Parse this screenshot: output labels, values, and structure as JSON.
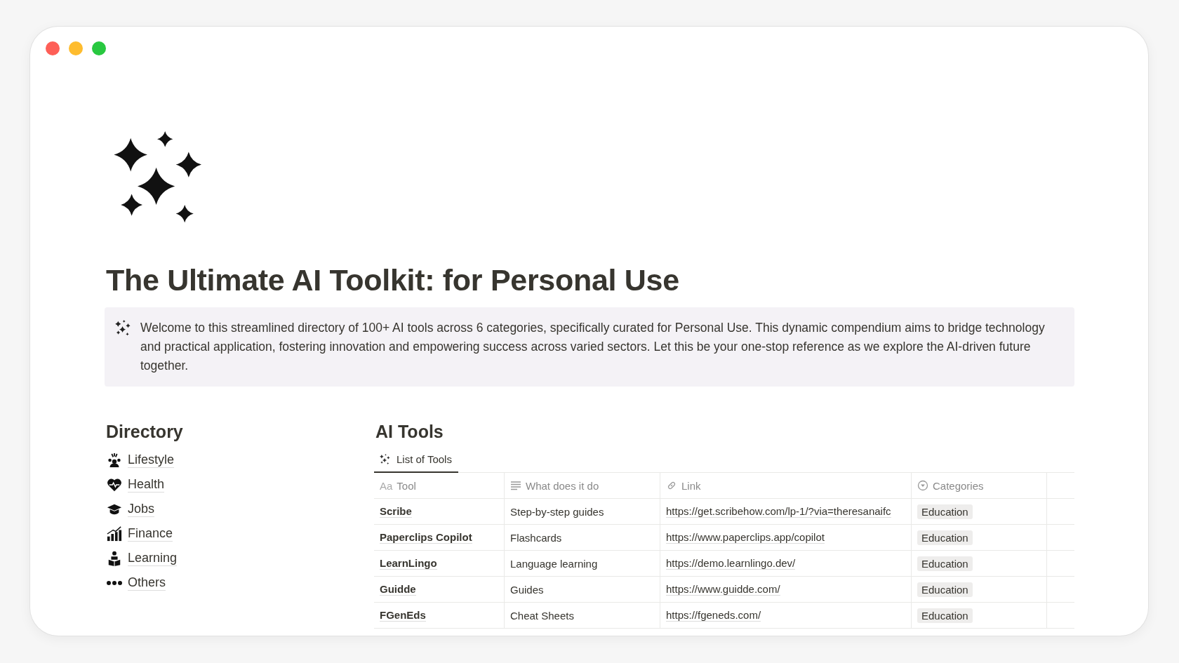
{
  "title": "The Ultimate AI Toolkit: for Personal Use",
  "callout": "Welcome to this streamlined directory of 100+ AI tools across 6 categories, specifically curated for Personal Use. This dynamic compendium aims to bridge technology and practical application, fostering innovation and empowering success across varied sectors. Let this be your one-stop reference as we explore the AI-driven future together.",
  "directory": {
    "heading": "Directory",
    "items": [
      {
        "kind": "lifestyle",
        "label": "Lifestyle"
      },
      {
        "kind": "health",
        "label": "Health"
      },
      {
        "kind": "jobs",
        "label": "Jobs"
      },
      {
        "kind": "finance",
        "label": "Finance"
      },
      {
        "kind": "learning",
        "label": "Learning"
      },
      {
        "kind": "others",
        "label": "Others"
      }
    ]
  },
  "tools": {
    "heading": "AI Tools",
    "tabs": [
      {
        "label": "List of Tools",
        "selected": true
      }
    ],
    "columns": [
      {
        "kind": "title",
        "icon_text": "Aa",
        "label": "Tool"
      },
      {
        "kind": "text",
        "label": "What does it do"
      },
      {
        "kind": "url",
        "label": "Link"
      },
      {
        "kind": "select",
        "label": "Categories"
      }
    ],
    "rows": [
      {
        "tool": "Scribe",
        "what": "Step-by-step guides",
        "link": "https://get.scribehow.com/lp-1/?via=theresanaifc",
        "category": "Education"
      },
      {
        "tool": "Paperclips Copilot",
        "what": "Flashcards",
        "link": "https://www.paperclips.app/copilot",
        "category": "Education"
      },
      {
        "tool": "LearnLingo",
        "what": "Language learning",
        "link": "https://demo.learnlingo.dev/",
        "category": "Education"
      },
      {
        "tool": "Guidde",
        "what": "Guides",
        "link": "https://www.guidde.com/",
        "category": "Education"
      },
      {
        "tool": "FGenEds",
        "what": "Cheat Sheets",
        "link": "https://fgeneds.com/",
        "category": "Education"
      }
    ]
  }
}
